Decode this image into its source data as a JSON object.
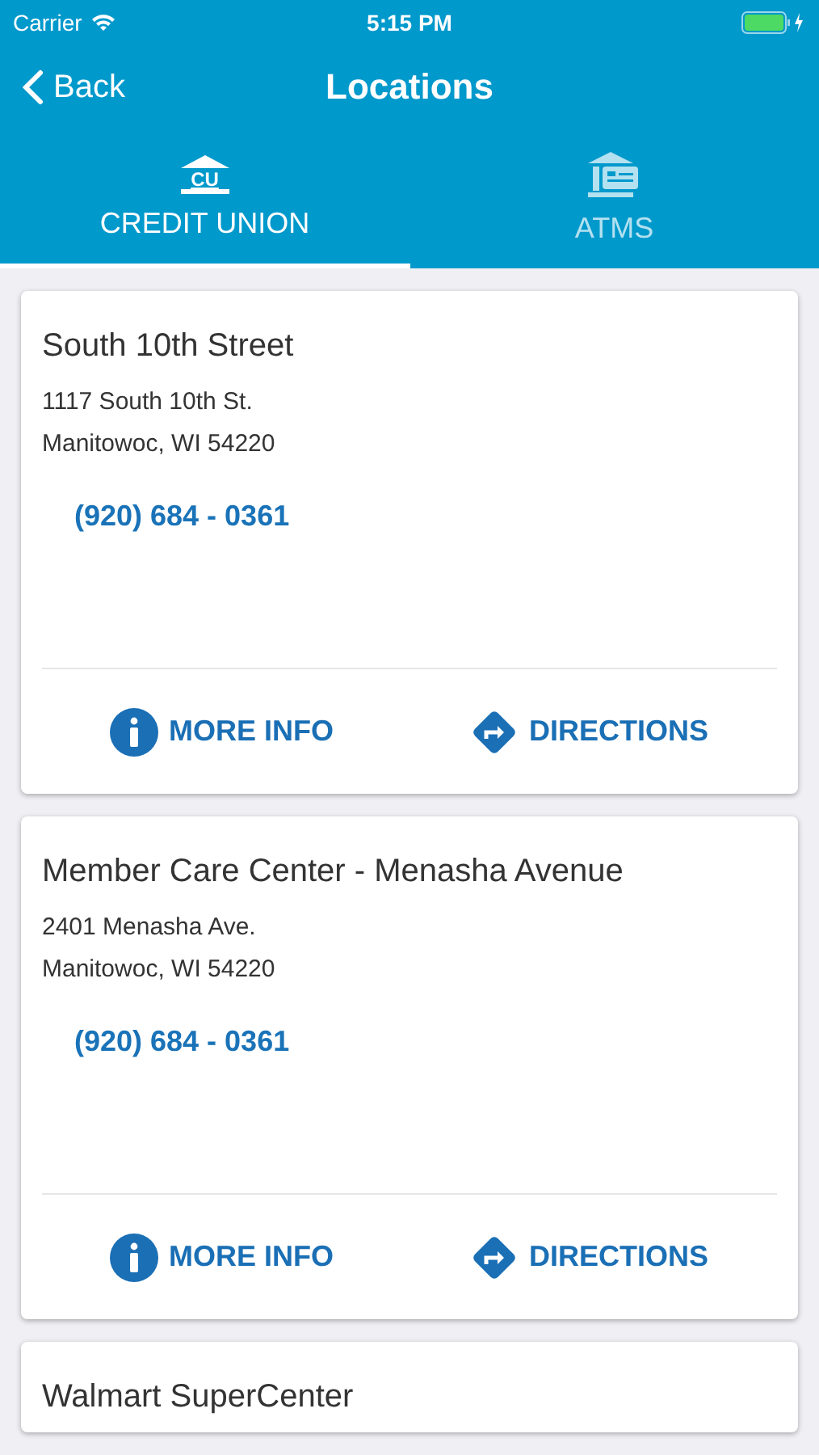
{
  "status_bar": {
    "carrier": "Carrier",
    "time": "5:15 PM"
  },
  "nav": {
    "back": "Back",
    "title": "Locations"
  },
  "tabs": [
    {
      "label": "CREDIT UNION",
      "kind": "branch",
      "icon_text": "CU",
      "selected": true
    },
    {
      "label": "ATMS",
      "kind": "atm",
      "selected": false
    }
  ],
  "locations": [
    {
      "name": "South 10th Street",
      "address": [
        "1117 South 10th St.",
        "Manitowoc, WI 54220"
      ],
      "phone": "(920) 684 - 0361",
      "actions": [
        "MORE INFO",
        "DIRECTIONS"
      ]
    },
    {
      "name": "Member Care Center - Menasha Avenue",
      "address": [
        "2401 Menasha Ave.",
        "Manitowoc, WI 54220"
      ],
      "phone": "(920) 684 - 0361",
      "actions": [
        "MORE INFO",
        "DIRECTIONS"
      ]
    },
    {
      "name": "Walmart SuperCenter"
    }
  ]
}
